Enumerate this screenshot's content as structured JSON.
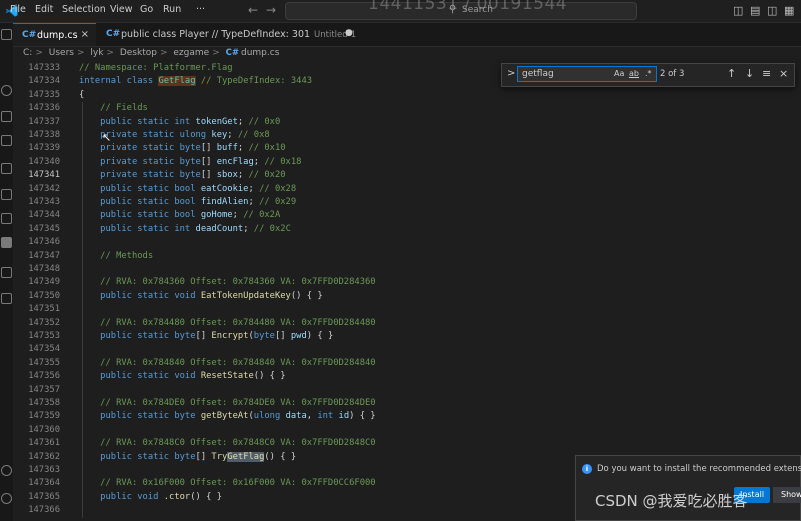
{
  "titlebar": {
    "menu": [
      "File",
      "Edit",
      "Selection",
      "View",
      "Go",
      "Run"
    ],
    "more": "···",
    "back_arrow": "←",
    "forward_arrow": "→",
    "search_placeholder": "Search",
    "overlay_text": "14411531 / 00191544"
  },
  "tabs": [
    {
      "icon": "C#",
      "label": "dump.cs",
      "close": "×"
    },
    {
      "icon": "C#",
      "label": "public class Player // TypeDefIndex: 301",
      "sub": "Untitled-1",
      "dirty": "●"
    }
  ],
  "breadcrumb": {
    "segments": [
      "C:",
      "Users",
      "lyk",
      "Desktop",
      "ezgame"
    ],
    "file": "dump.cs",
    "file_icon": "C#",
    "separator": ">"
  },
  "find": {
    "toggle": ">",
    "query": "getflag",
    "options": [
      "Aa",
      "ab",
      ".*"
    ],
    "count": "2 of 3",
    "prev": "↑",
    "next": "↓",
    "selection": "≡",
    "close": "×"
  },
  "editor": {
    "active_line": "147341",
    "lines": [
      {
        "n": "147333",
        "segs": [
          [
            "c",
            "// Namespace: Platformer.Flag"
          ]
        ]
      },
      {
        "n": "147334",
        "segs": [
          [
            "k",
            "internal class "
          ],
          [
            "t hl",
            "GetFlag"
          ],
          [
            "c",
            " // TypeDefIndex: 3443"
          ]
        ]
      },
      {
        "n": "147335",
        "segs": [
          [
            "p",
            "{"
          ]
        ]
      },
      {
        "n": "147336",
        "segs": [
          [
            "c",
            "    // Fields"
          ]
        ]
      },
      {
        "n": "147337",
        "segs": [
          [
            "k",
            "    public static int "
          ],
          [
            "i",
            "tokenGet"
          ],
          [
            "p",
            "; "
          ],
          [
            "c",
            "// 0x0"
          ]
        ]
      },
      {
        "n": "147338",
        "segs": [
          [
            "k",
            "    private static ulong "
          ],
          [
            "i",
            "key"
          ],
          [
            "p",
            "; "
          ],
          [
            "c",
            "// 0x8"
          ]
        ]
      },
      {
        "n": "147339",
        "segs": [
          [
            "k",
            "    private static byte"
          ],
          [
            "p",
            "[] "
          ],
          [
            "i",
            "buff"
          ],
          [
            "p",
            "; "
          ],
          [
            "c",
            "// 0x10"
          ]
        ]
      },
      {
        "n": "147340",
        "segs": [
          [
            "k",
            "    private static byte"
          ],
          [
            "p",
            "[] "
          ],
          [
            "i",
            "encFlag"
          ],
          [
            "p",
            "; "
          ],
          [
            "c",
            "// 0x18"
          ]
        ]
      },
      {
        "n": "147341",
        "segs": [
          [
            "k",
            "    private static byte"
          ],
          [
            "p",
            "[] "
          ],
          [
            "i",
            "sbox"
          ],
          [
            "p",
            "; "
          ],
          [
            "c",
            "// 0x20"
          ]
        ]
      },
      {
        "n": "147342",
        "segs": [
          [
            "k",
            "    public static bool "
          ],
          [
            "i",
            "eatCookie"
          ],
          [
            "p",
            "; "
          ],
          [
            "c",
            "// 0x28"
          ]
        ]
      },
      {
        "n": "147343",
        "segs": [
          [
            "k",
            "    public static bool "
          ],
          [
            "i",
            "findAlien"
          ],
          [
            "p",
            "; "
          ],
          [
            "c",
            "// 0x29"
          ]
        ]
      },
      {
        "n": "147344",
        "segs": [
          [
            "k",
            "    public static bool "
          ],
          [
            "i",
            "goHome"
          ],
          [
            "p",
            "; "
          ],
          [
            "c",
            "// 0x2A"
          ]
        ]
      },
      {
        "n": "147345",
        "segs": [
          [
            "k",
            "    public static int "
          ],
          [
            "i",
            "deadCount"
          ],
          [
            "p",
            "; "
          ],
          [
            "c",
            "// 0x2C"
          ]
        ]
      },
      {
        "n": "147346",
        "segs": []
      },
      {
        "n": "147347",
        "segs": [
          [
            "c",
            "    // Methods"
          ]
        ]
      },
      {
        "n": "147348",
        "segs": []
      },
      {
        "n": "147349",
        "segs": [
          [
            "c",
            "    // RVA: 0x784360 Offset: 0x784360 VA: 0x7FFD0D284360"
          ]
        ]
      },
      {
        "n": "147350",
        "segs": [
          [
            "k",
            "    public static void "
          ],
          [
            "f",
            "EatTokenUpdateKey"
          ],
          [
            "p",
            "() { }"
          ]
        ]
      },
      {
        "n": "147351",
        "segs": []
      },
      {
        "n": "147352",
        "segs": [
          [
            "c",
            "    // RVA: 0x784480 Offset: 0x784480 VA: 0x7FFD0D284480"
          ]
        ]
      },
      {
        "n": "147353",
        "segs": [
          [
            "k",
            "    public static byte"
          ],
          [
            "p",
            "[] "
          ],
          [
            "f",
            "Encrypt"
          ],
          [
            "p",
            "("
          ],
          [
            "k",
            "byte"
          ],
          [
            "p",
            "[] "
          ],
          [
            "i",
            "pwd"
          ],
          [
            "p",
            ") { }"
          ]
        ]
      },
      {
        "n": "147354",
        "segs": []
      },
      {
        "n": "147355",
        "segs": [
          [
            "c",
            "    // RVA: 0x784840 Offset: 0x784840 VA: 0x7FFD0D284840"
          ]
        ]
      },
      {
        "n": "147356",
        "segs": [
          [
            "k",
            "    public static void "
          ],
          [
            "f",
            "ResetState"
          ],
          [
            "p",
            "() { }"
          ]
        ]
      },
      {
        "n": "147357",
        "segs": []
      },
      {
        "n": "147358",
        "segs": [
          [
            "c",
            "    // RVA: 0x784DE0 Offset: 0x784DE0 VA: 0x7FFD0D284DE0"
          ]
        ]
      },
      {
        "n": "147359",
        "segs": [
          [
            "k",
            "    public static byte "
          ],
          [
            "f",
            "getByteAt"
          ],
          [
            "p",
            "("
          ],
          [
            "k",
            "ulong "
          ],
          [
            "i",
            "data"
          ],
          [
            "p",
            ", "
          ],
          [
            "k",
            "int "
          ],
          [
            "i",
            "id"
          ],
          [
            "p",
            ") { }"
          ]
        ]
      },
      {
        "n": "147360",
        "segs": []
      },
      {
        "n": "147361",
        "segs": [
          [
            "c",
            "    // RVA: 0x7848C0 Offset: 0x7848C0 VA: 0x7FFD0D2848C0"
          ]
        ]
      },
      {
        "n": "147362",
        "segs": [
          [
            "k",
            "    public static byte"
          ],
          [
            "p",
            "[] "
          ],
          [
            "f",
            "Try"
          ],
          [
            "f hl2",
            "GetFlag"
          ],
          [
            "p",
            "() { }"
          ]
        ]
      },
      {
        "n": "147363",
        "segs": []
      },
      {
        "n": "147364",
        "segs": [
          [
            "c",
            "    // RVA: 0x16F000 Offset: 0x16F000 VA: 0x7FFD0CC6F000"
          ]
        ]
      },
      {
        "n": "147365",
        "segs": [
          [
            "k",
            "    public void "
          ],
          [
            "f",
            ".ctor"
          ],
          [
            "p",
            "() { }"
          ]
        ]
      },
      {
        "n": "147366",
        "segs": []
      }
    ]
  },
  "notification": {
    "icon": "i",
    "text": "Do you want to install the recommended extensions",
    "install_label": "Install",
    "show_label": "Show"
  },
  "watermark": "CSDN @我爱吃必胜客",
  "colors": {
    "background": "#1e1e1e",
    "keyword": "#569cd6",
    "type": "#4ec9b0",
    "comment": "#6a9955",
    "identifier": "#9cdcfe",
    "function": "#dcdcaa",
    "accent": "#0078d4",
    "find_highlight": "#613214"
  }
}
